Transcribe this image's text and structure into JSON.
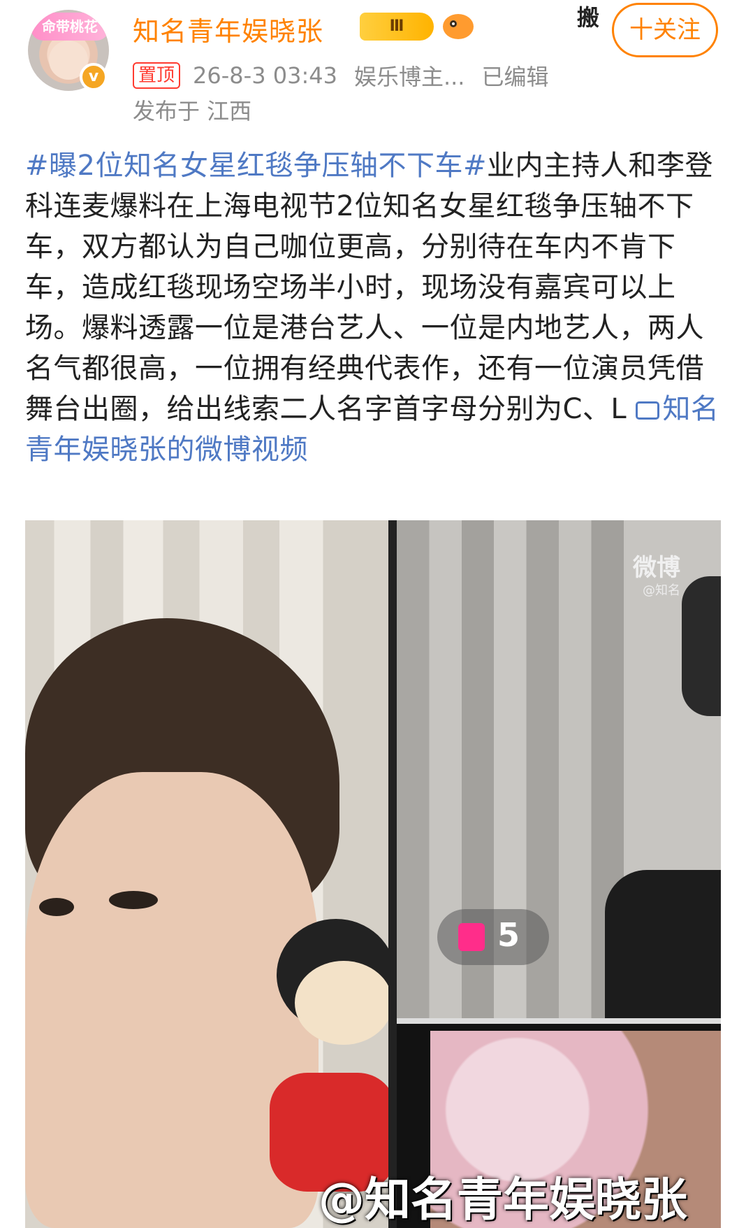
{
  "user": {
    "name": "知名青年娱晓张",
    "avatar_sticker_text": "命带桃花",
    "verified_mark": "v",
    "level_badge": "Ⅲ"
  },
  "corner_sticker": "搬",
  "follow_button": "十关注",
  "meta": {
    "pinned": "置顶",
    "timestamp": "26-8-3 03:43",
    "category": "娱乐博主...",
    "edited": "已编辑",
    "location": "发布于 江西"
  },
  "post": {
    "topic": "#曝2位知名女星红毯争压轴不下车#",
    "body": "业内主持人和李登科连麦爆料在上海电视节2位知名女星红毯争压轴不下车，双方都认为自己咖位更高，分别待在车内不肯下车，造成红毯现场空场半小时，现场没有嘉宾可以上场。爆料透露一位是港台艺人、一位是内地艺人，两人名气都很高，一位拥有经典代表作，还有一位演员凭借舞台出圈，给出线索二人名字首字母分别为C、L ",
    "video_link": "知名青年娱晓张的微博视频"
  },
  "media": {
    "watermark": "微博",
    "watermark_sub": "@知名",
    "gift_count": "5",
    "handle_overlay": "@知名青年娱晓张"
  }
}
